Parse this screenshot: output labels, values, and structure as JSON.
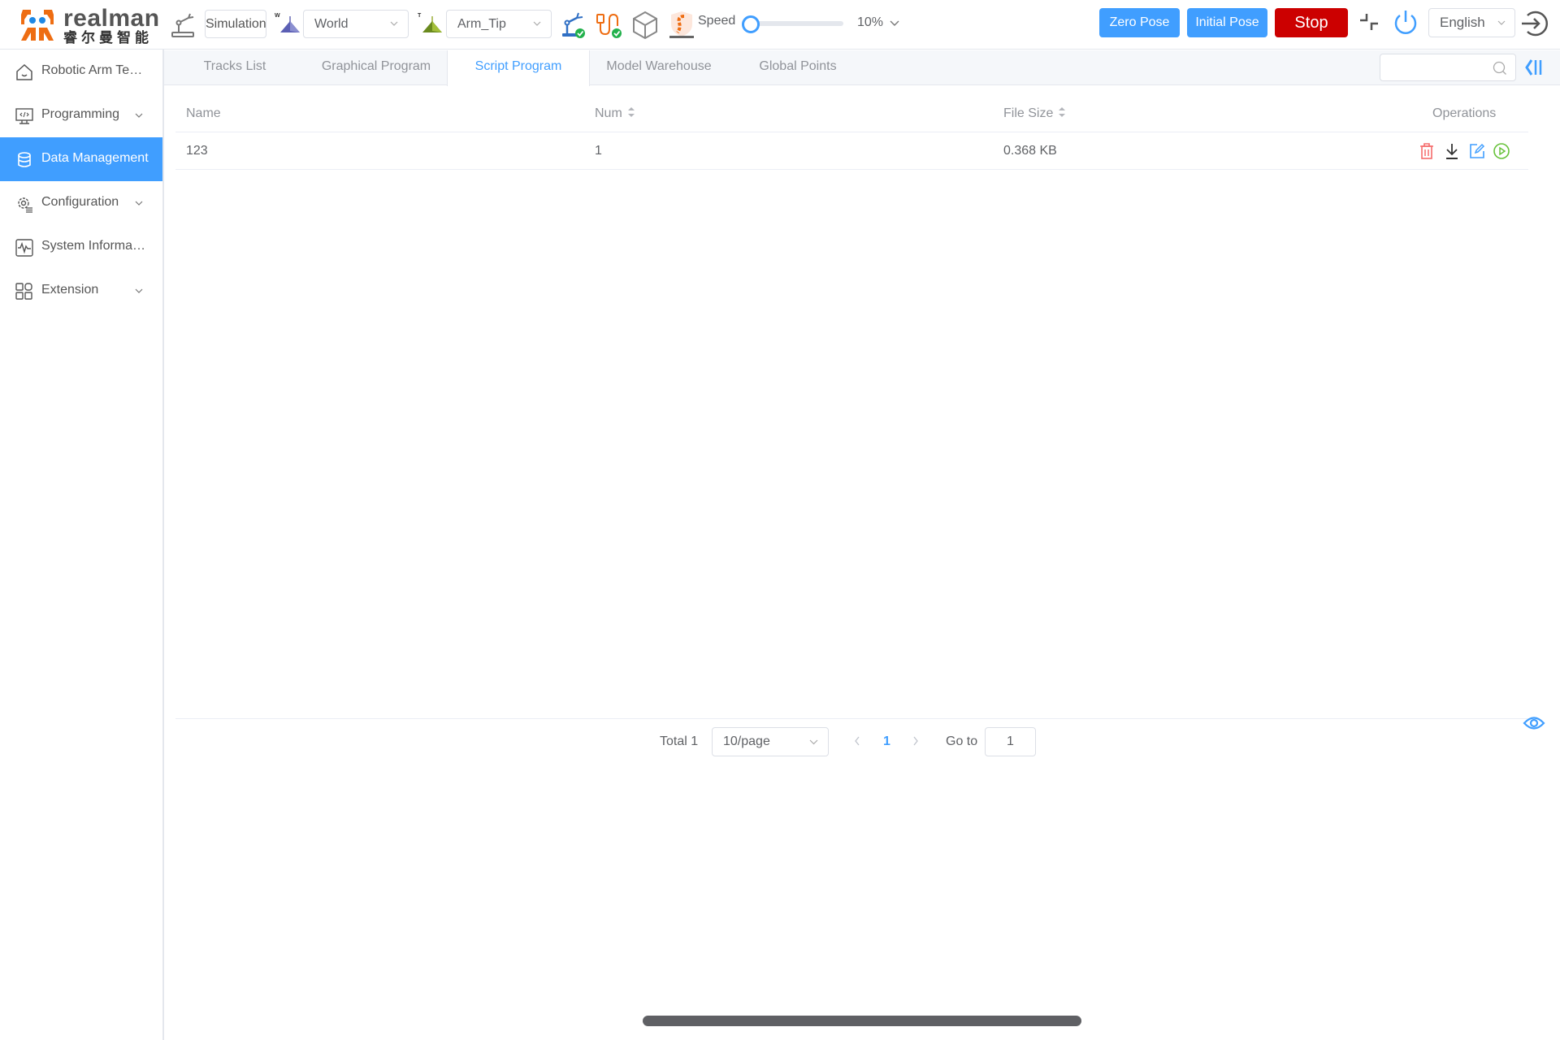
{
  "header": {
    "logo": {
      "brand": "realman",
      "brand_cn": "睿尔曼智能",
      "orange": "#ee6d12",
      "blue": "#1e88e5"
    },
    "mode_label": "Simulation",
    "coord_frame": {
      "icon": "world-frame-icon",
      "badge": "W",
      "selected": "World"
    },
    "tool_frame": {
      "icon": "tool-frame-icon",
      "badge": "T",
      "selected": "Arm_Tip"
    },
    "status_icons": [
      "arm-connected-icon",
      "io-connected-icon",
      "model-cube-icon",
      "collision-safety-icon"
    ],
    "speed": {
      "label": "Speed",
      "value_text": "10%",
      "fraction": 0.1
    },
    "buttons": {
      "zero_pose": "Zero Pose",
      "initial_pose": "Initial Pose",
      "stop": "Stop"
    },
    "language": "English",
    "colors": {
      "primary": "#409eff",
      "stop": "#cc0000"
    }
  },
  "sidebar": {
    "items": [
      {
        "label": "Robotic Arm Teaching",
        "icon": "home-icon",
        "expandable": false,
        "active": false
      },
      {
        "label": "Programming",
        "icon": "code-monitor-icon",
        "expandable": true,
        "active": false
      },
      {
        "label": "Data Management",
        "icon": "database-icon",
        "expandable": false,
        "active": true
      },
      {
        "label": "Configuration",
        "icon": "gear-settings-icon",
        "expandable": true,
        "active": false
      },
      {
        "label": "System Information",
        "icon": "pulse-monitor-icon",
        "expandable": false,
        "active": false
      },
      {
        "label": "Extension",
        "icon": "grid-apps-icon",
        "expandable": true,
        "active": false
      }
    ]
  },
  "tabs": [
    {
      "label": "Tracks List",
      "active": false
    },
    {
      "label": "Graphical Program",
      "active": false
    },
    {
      "label": "Script Program",
      "active": true
    },
    {
      "label": "Model Warehouse",
      "active": false
    },
    {
      "label": "Global Points",
      "active": false
    }
  ],
  "search": {
    "placeholder": "",
    "value": ""
  },
  "table": {
    "columns": [
      "Name",
      "Num",
      "File Size",
      "Operations"
    ],
    "rows": [
      {
        "name": "123",
        "num": "1",
        "file_size": "0.368 KB"
      }
    ],
    "operations": [
      "delete-icon",
      "download-icon",
      "edit-icon",
      "run-icon"
    ]
  },
  "pagination": {
    "total_text": "Total 1",
    "page_size": "10/page",
    "current_page": "1",
    "goto_label": "Go to",
    "goto_value": "1"
  }
}
